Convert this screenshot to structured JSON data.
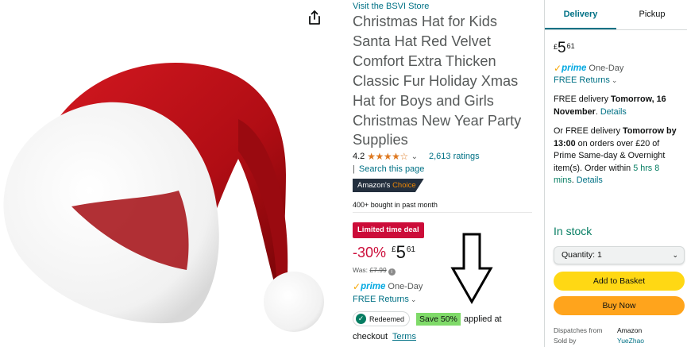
{
  "image": {
    "share_icon": "share-icon",
    "product_image_alt": "Red santa hat with white fur trim"
  },
  "details": {
    "store_link": "Visit the BSVI Store",
    "title": "Christmas Hat for Kids Santa Hat Red Velvet Comfort Extra Thicken Classic Fur Holiday Xmas Hat for Boys and Girls Christmas New Year Party Supplies",
    "rating": "4.2",
    "stars": "★★★★☆",
    "ratings_count": "2,613 ratings",
    "pipe": "|",
    "search_link": "Search this page",
    "choice_prefix": "Amazon's",
    "choice_word": "Choice",
    "bought": "400+ bought in past month",
    "deal_badge": "Limited time deal",
    "discount": "-30%",
    "currency": "£",
    "price_whole": "5",
    "price_fraction": "61",
    "was_label": "Was:",
    "was_price": "£7.99",
    "prime_check": "✓",
    "prime_logo": "prime",
    "prime_text": "One-Day",
    "returns": "FREE Returns",
    "redeemed": "Redeemed",
    "save_badge": "Save 50%",
    "applied_text": "applied at",
    "checkout_text": "checkout",
    "terms_link": "Terms"
  },
  "buybox": {
    "tab_delivery": "Delivery",
    "tab_pickup": "Pickup",
    "currency": "£",
    "price_whole": "5",
    "price_fraction": "61",
    "prime_check": "✓",
    "prime_logo": "prime",
    "prime_text": "One-Day",
    "returns": "FREE Returns",
    "delivery_prefix": "FREE delivery ",
    "delivery_date": "Tomorrow, 16 November",
    "delivery_sep": ". ",
    "details_link": "Details",
    "fast_prefix": "Or FREE delivery ",
    "fast_time": "Tomorrow by 13:00",
    "fast_middle": " on orders over £20 of Prime Same-day & Overnight item(s). Order within ",
    "fast_countdown": "5 hrs 8 mins",
    "fast_sep": ". ",
    "fast_details_link": "Details",
    "in_stock": "In stock",
    "quantity": "Quantity: 1",
    "add_to_basket": "Add to Basket",
    "buy_now": "Buy Now",
    "dispatches_label": "Dispatches from",
    "dispatches_value": "Amazon",
    "sold_by_label": "Sold by",
    "sold_by_value": "YueZhao"
  },
  "colors": {
    "link": "#007185",
    "deal_red": "#cc0c39",
    "basket_yellow": "#ffd814",
    "buy_orange": "#ffa41c",
    "stock_green": "#067d62",
    "save_green": "#7fda69",
    "star_orange": "#de7921",
    "prime_blue": "#00a8e1"
  }
}
